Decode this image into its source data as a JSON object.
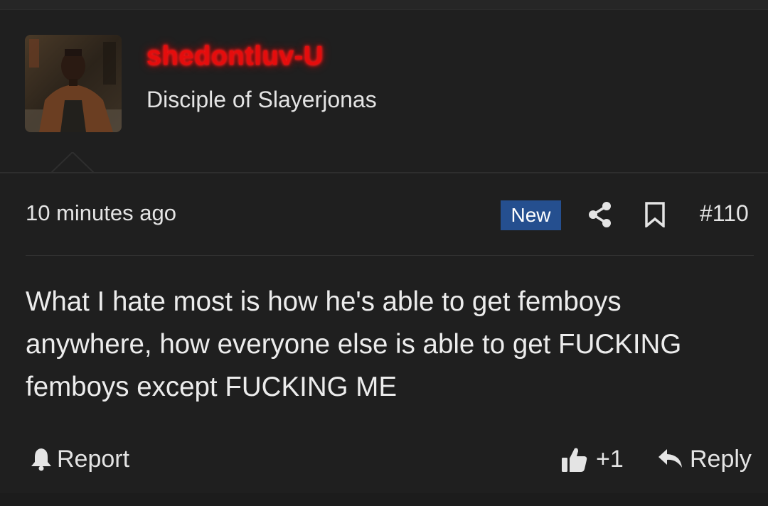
{
  "user": {
    "name": "shedontluv-U",
    "title": "Disciple of Slayerjonas",
    "name_color": "#e50d0d"
  },
  "post": {
    "timestamp": "10 minutes ago",
    "badge": "New",
    "number": "#110",
    "message": "What I hate most is how he's able to get femboys anywhere, how everyone else is able to get FUCKING femboys except FUCKING ME"
  },
  "actions": {
    "report_label": "Report",
    "like_count": "+1",
    "reply_label": "Reply"
  },
  "icons": {
    "share": "share-icon",
    "bookmark": "bookmark-icon",
    "report": "bell-icon",
    "like": "thumbs-up-icon",
    "reply": "reply-arrow-icon"
  },
  "colors": {
    "background": "#1f1f1f",
    "badge": "#254f8f",
    "text": "#e4e4e4"
  }
}
